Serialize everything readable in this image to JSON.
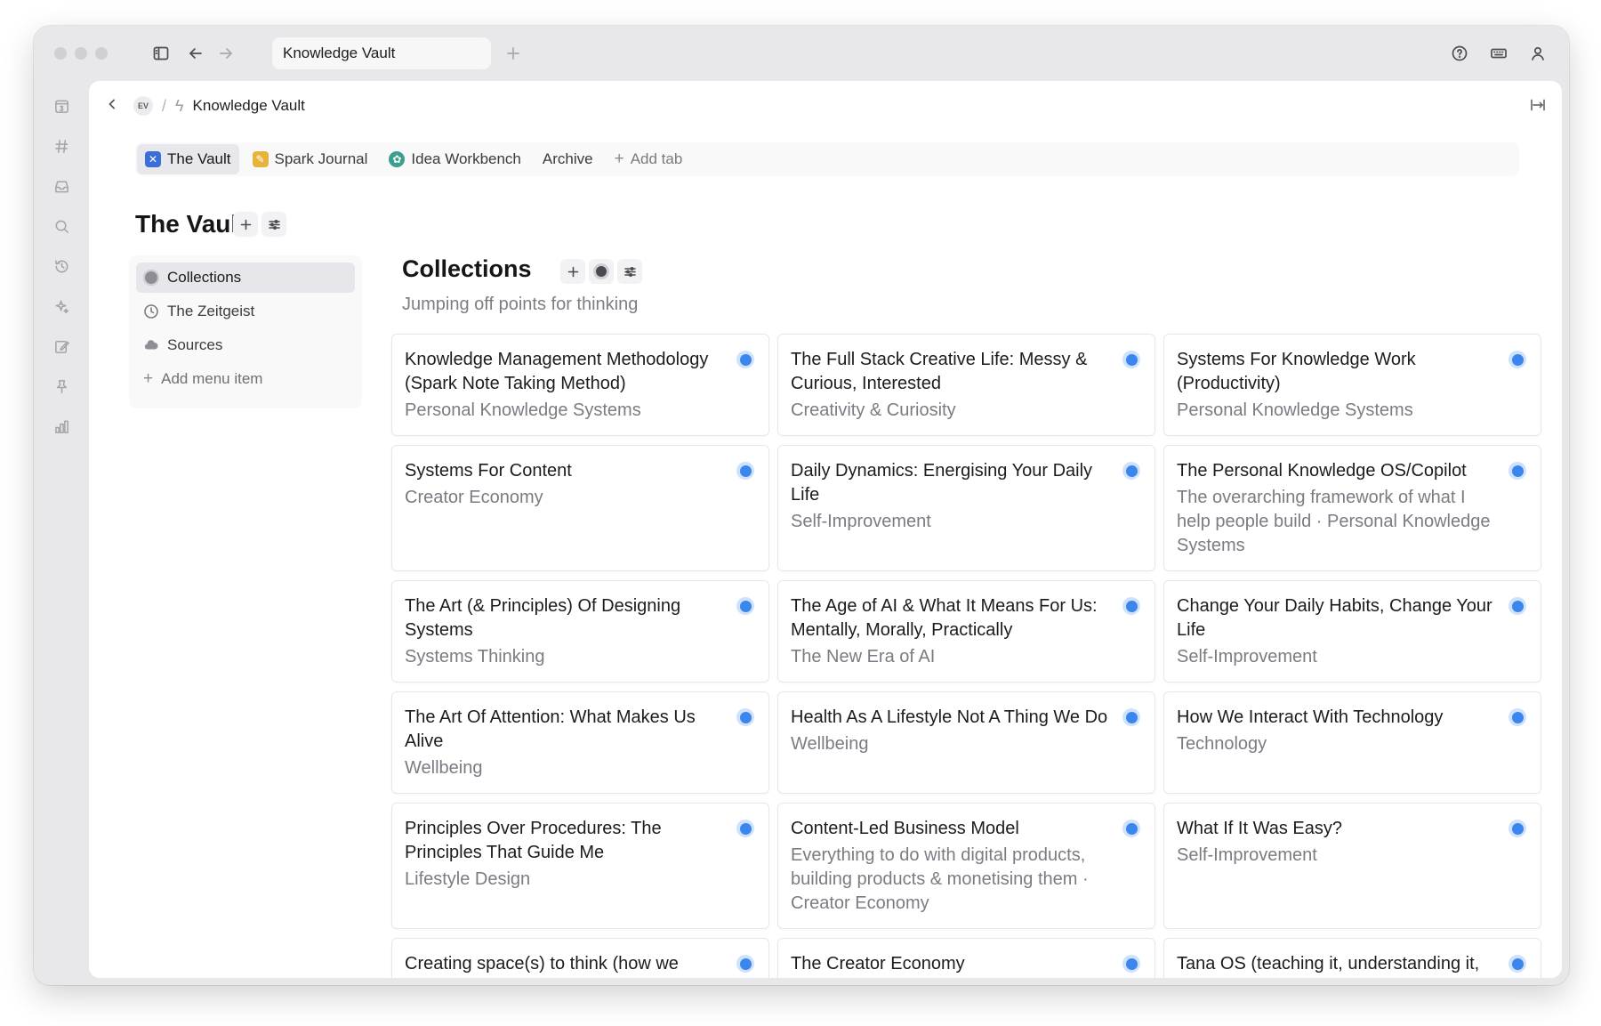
{
  "window": {
    "tab_title": "Knowledge Vault"
  },
  "breadcrumb": {
    "workspace_badge": "EV",
    "separator": "/",
    "page": "Knowledge Vault"
  },
  "tabs": [
    {
      "label": "The Vault",
      "icon": "vault-icon",
      "color": "#3b6fd8",
      "active": true
    },
    {
      "label": "Spark Journal",
      "icon": "notebook-icon",
      "color": "#e6b33b",
      "active": false
    },
    {
      "label": "Idea Workbench",
      "icon": "workbench-icon",
      "color": "#3a9f8e",
      "active": false
    },
    {
      "label": "Archive",
      "icon": "",
      "color": "",
      "active": false
    }
  ],
  "add_tab_label": "Add tab",
  "page_title": "The Vault",
  "menu": {
    "items": [
      {
        "label": "Collections",
        "icon": "collections-icon",
        "active": true
      },
      {
        "label": "The Zeitgeist",
        "icon": "clock-icon",
        "active": false
      },
      {
        "label": "Sources",
        "icon": "cloud-icon",
        "active": false
      }
    ],
    "add_label": "Add menu item"
  },
  "collections": {
    "title": "Collections",
    "subtitle": "Jumping off points for thinking",
    "cards": [
      {
        "title": "Knowledge Management Methodology (Spark Note Taking Method)",
        "subtitle": "Personal Knowledge Systems"
      },
      {
        "title": "The Full Stack Creative Life: Messy & Curious, Interested",
        "subtitle": "Creativity & Curiosity"
      },
      {
        "title": "Systems For Knowledge Work (Productivity)",
        "subtitle": "Personal Knowledge Systems"
      },
      {
        "title": "Systems For Content",
        "subtitle": "Creator Economy"
      },
      {
        "title": "Daily Dynamics: Energising Your Daily Life",
        "subtitle": "Self-Improvement"
      },
      {
        "title": "The Personal Knowledge OS/Copilot",
        "subtitle": "The overarching framework of what I help people build · Personal Knowledge Systems"
      },
      {
        "title": "The Art (& Principles) Of Designing Systems",
        "subtitle": "Systems Thinking"
      },
      {
        "title": "The Age of AI & What It Means For Us: Mentally, Morally, Practically",
        "subtitle": "The New Era of AI"
      },
      {
        "title": "Change Your Daily Habits, Change Your Life",
        "subtitle": "Self-Improvement"
      },
      {
        "title": "The Art Of Attention: What Makes Us Alive",
        "subtitle": "Wellbeing"
      },
      {
        "title": "Health As A Lifestyle Not A Thing We Do",
        "subtitle": "Wellbeing"
      },
      {
        "title": "How We Interact With Technology",
        "subtitle": "Technology"
      },
      {
        "title": "Principles Over Procedures: The Principles That Guide Me",
        "subtitle": "Lifestyle Design"
      },
      {
        "title": "Content-Led Business Model",
        "subtitle": "Everything to do with digital products, building products & monetising them · Creator Economy"
      },
      {
        "title": "What If It Was Easy?",
        "subtitle": "Self-Improvement"
      },
      {
        "title": "Creating space(s) to think (how we",
        "subtitle": ""
      },
      {
        "title": "The Creator Economy",
        "subtitle": ""
      },
      {
        "title": "Tana OS (teaching it, understanding it,",
        "subtitle": ""
      }
    ]
  },
  "colors": {
    "accent": "#3a86ec",
    "window_chrome": "#e8e8ea"
  }
}
